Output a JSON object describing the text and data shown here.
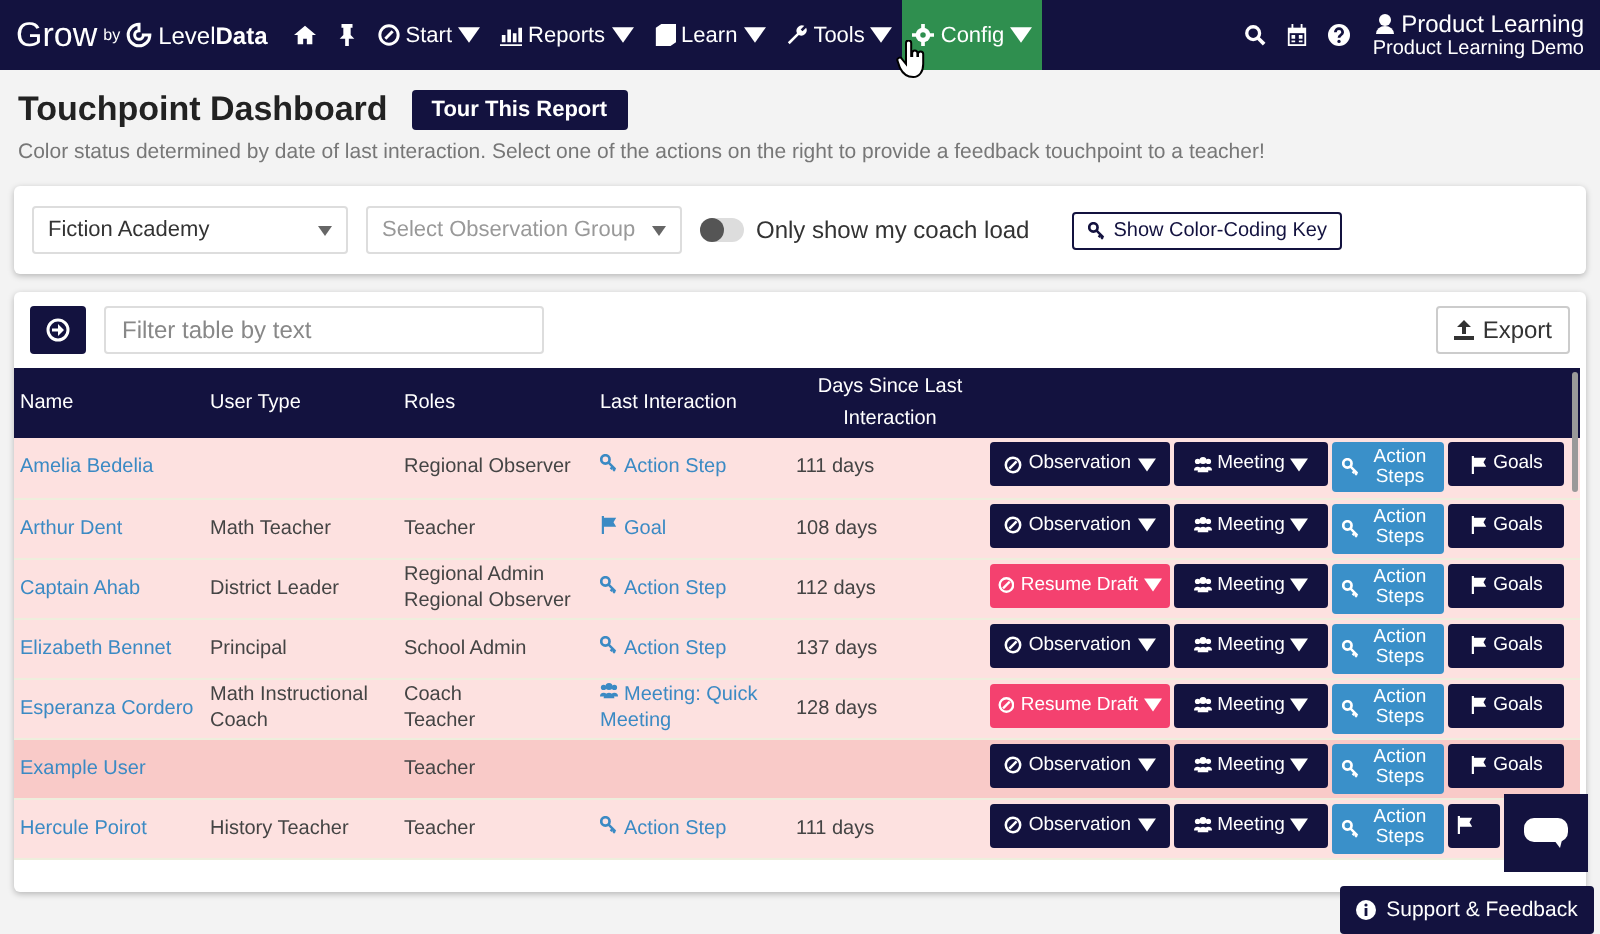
{
  "nav": {
    "logo": {
      "main": "Grow",
      "by": "by",
      "brand_a": "Level",
      "brand_b": "Data"
    },
    "menus": [
      {
        "label": "Start",
        "selected": false
      },
      {
        "label": "Reports",
        "selected": false
      },
      {
        "label": "Learn",
        "selected": false
      },
      {
        "label": "Tools",
        "selected": false
      },
      {
        "label": "Config",
        "selected": true
      }
    ],
    "user": {
      "name": "Product Learning",
      "org": "Product Learning Demo"
    }
  },
  "page": {
    "title": "Touchpoint Dashboard",
    "tour_button": "Tour This Report",
    "subtitle": "Color status determined by date of last interaction. Select one of the actions on the right to provide a feedback touchpoint to a teacher!"
  },
  "filters": {
    "school": {
      "value": "Fiction Academy"
    },
    "group": {
      "placeholder": "Select Observation Group"
    },
    "coach_toggle": {
      "label": "Only show my coach load",
      "on": false
    },
    "key_button": "Show Color-Coding Key"
  },
  "table": {
    "search": {
      "placeholder": "Filter table by text"
    },
    "export": "Export",
    "columns": [
      "Name",
      "User Type",
      "Roles",
      "Last Interaction",
      "Days Since Last Interaction"
    ],
    "rows": [
      {
        "name": "Amelia Bedelia",
        "roles": [
          "Regional Observer"
        ],
        "last": {
          "kind": "action_step",
          "text": "Action Step"
        },
        "days": "111 days",
        "color": "#fde1e0",
        "observation": {
          "kind": "new",
          "label": "Observation"
        },
        "meeting": "Meeting",
        "action_steps": "Action Steps",
        "goals": "Goals"
      },
      {
        "name": "Arthur Dent",
        "user_type": "Math Teacher",
        "roles": [
          "Teacher"
        ],
        "last": {
          "kind": "goal",
          "text": "Goal"
        },
        "days": "108 days",
        "color": "#fde1e0",
        "observation": {
          "kind": "new",
          "label": "Observation"
        },
        "meeting": "Meeting",
        "action_steps": "Action Steps",
        "goals": "Goals"
      },
      {
        "name": "Captain Ahab",
        "user_type": "District Leader",
        "roles": [
          "Regional Admin",
          "Regional Observer"
        ],
        "last": {
          "kind": "action_step",
          "text": "Action Step"
        },
        "days": "112 days",
        "color": "#fde1e0",
        "observation": {
          "kind": "draft",
          "label": "Resume Draft"
        },
        "meeting": "Meeting",
        "action_steps": "Action Steps",
        "goals": "Goals"
      },
      {
        "name": "Elizabeth Bennet",
        "user_type": "Principal",
        "roles": [
          "School Admin"
        ],
        "last": {
          "kind": "action_step",
          "text": "Action Step"
        },
        "days": "137 days",
        "color": "#fde1e0",
        "observation": {
          "kind": "new",
          "label": "Observation"
        },
        "meeting": "Meeting",
        "action_steps": "Action Steps",
        "goals": "Goals"
      },
      {
        "name": "Esperanza Cordero",
        "user_type": "Math Instructional Coach",
        "roles": [
          "Coach",
          "Teacher"
        ],
        "last": {
          "kind": "meeting",
          "text": "Meeting: Quick Meeting"
        },
        "days": "128 days",
        "color": "#fde1e0",
        "observation": {
          "kind": "draft",
          "label": "Resume Draft"
        },
        "meeting": "Meeting",
        "action_steps": "Action Steps",
        "goals": "Goals"
      },
      {
        "name": "Example User",
        "roles": [
          "Teacher"
        ],
        "color": "#f9cac8",
        "observation": {
          "kind": "new",
          "label": "Observation"
        },
        "meeting": "Meeting",
        "action_steps": "Action Steps",
        "goals": "Goals"
      },
      {
        "name": "Hercule Poirot",
        "user_type": "History Teacher",
        "roles": [
          "Teacher"
        ],
        "last": {
          "kind": "action_step",
          "text": "Action Step"
        },
        "days": "111 days",
        "color": "#fde1e0",
        "observation": {
          "kind": "new",
          "label": "Observation"
        },
        "meeting": "Meeting",
        "action_steps": "Action Steps"
      }
    ]
  },
  "support_button": "Support & Feedback"
}
